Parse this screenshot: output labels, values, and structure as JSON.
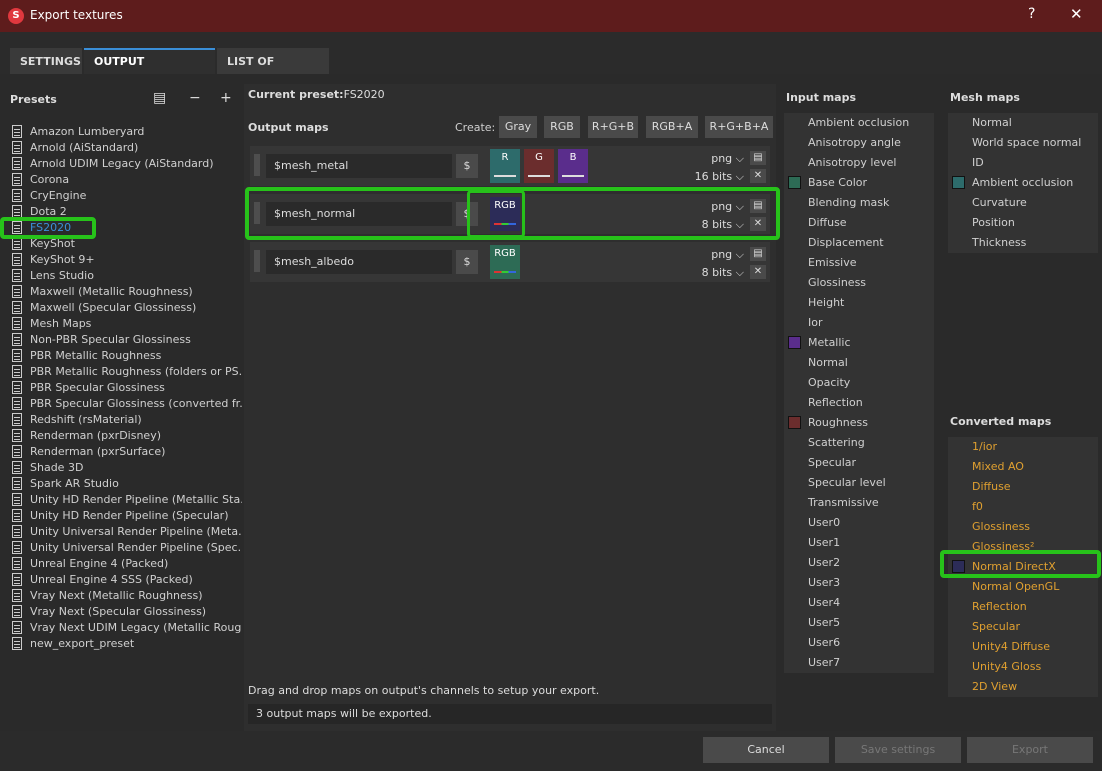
{
  "window": {
    "title": "Export textures",
    "help": "?",
    "close": "✕"
  },
  "tabs": [
    {
      "label": "SETTINGS",
      "active": false
    },
    {
      "label": "OUTPUT TEMPLATES",
      "active": true
    },
    {
      "label": "LIST OF EXPORTS",
      "active": false
    }
  ],
  "presets": {
    "title": "Presets",
    "items": [
      "Amazon Lumberyard",
      "Arnold (AiStandard)",
      "Arnold UDIM Legacy (AiStandard)",
      "Corona",
      "CryEngine",
      "Dota 2",
      "FS2020",
      "KeyShot",
      "KeyShot 9+",
      "Lens Studio",
      "Maxwell (Metallic Roughness)",
      "Maxwell (Specular Glossiness)",
      "Mesh Maps",
      "Non-PBR Specular Glossiness",
      "PBR Metallic Roughness",
      "PBR Metallic Roughness (folders or PS...",
      "PBR Specular Glossiness",
      "PBR Specular Glossiness (converted fr...",
      "Redshift (rsMaterial)",
      "Renderman (pxrDisney)",
      "Renderman (pxrSurface)",
      "Shade 3D",
      "Spark AR Studio",
      "Unity HD Render Pipeline (Metallic Sta...",
      "Unity HD Render Pipeline (Specular)",
      "Unity Universal Render Pipeline (Meta...",
      "Unity Universal Render Pipeline (Spec...",
      "Unreal Engine 4 (Packed)",
      "Unreal Engine 4 SSS (Packed)",
      "Vray Next (Metallic Roughness)",
      "Vray Next (Specular Glossiness)",
      "Vray Next UDIM Legacy (Metallic Roug...",
      "new_export_preset"
    ],
    "selected": "FS2020"
  },
  "current": {
    "label": "Current preset:",
    "value": "FS2020"
  },
  "output": {
    "label": "Output maps",
    "create_label": "Create:",
    "create_buttons": [
      "Gray",
      "RGB",
      "R+G+B",
      "RGB+A",
      "R+G+B+A"
    ],
    "rows": [
      {
        "name": "$mesh_metal",
        "dollar": "$",
        "format": "png",
        "bits": "16 bits",
        "channels": [
          {
            "label": "R",
            "color": "#2d6b6b"
          },
          {
            "label": "G",
            "color": "#6b2d2d"
          },
          {
            "label": "B",
            "color": "#5a2d8c"
          }
        ]
      },
      {
        "name": "$mesh_normal",
        "dollar": "$",
        "format": "png",
        "bits": "8 bits",
        "channels": [
          {
            "label": "RGB",
            "color": "#2c2c58"
          }
        ]
      },
      {
        "name": "$mesh_albedo",
        "dollar": "$",
        "format": "png",
        "bits": "8 bits",
        "channels": [
          {
            "label": "RGB",
            "color": "#2d6b55"
          }
        ]
      }
    ],
    "hint": "Drag and drop maps on output's channels to setup your export.",
    "status": "3 output maps will be exported."
  },
  "input_maps": {
    "title": "Input maps",
    "items": [
      {
        "label": "Ambient occlusion",
        "swatch": ""
      },
      {
        "label": "Anisotropy angle",
        "swatch": ""
      },
      {
        "label": "Anisotropy level",
        "swatch": ""
      },
      {
        "label": "Base Color",
        "swatch": "#2d6b55"
      },
      {
        "label": "Blending mask",
        "swatch": ""
      },
      {
        "label": "Diffuse",
        "swatch": ""
      },
      {
        "label": "Displacement",
        "swatch": ""
      },
      {
        "label": "Emissive",
        "swatch": ""
      },
      {
        "label": "Glossiness",
        "swatch": ""
      },
      {
        "label": "Height",
        "swatch": ""
      },
      {
        "label": "Ior",
        "swatch": ""
      },
      {
        "label": "Metallic",
        "swatch": "#5a2d8c"
      },
      {
        "label": "Normal",
        "swatch": ""
      },
      {
        "label": "Opacity",
        "swatch": ""
      },
      {
        "label": "Reflection",
        "swatch": ""
      },
      {
        "label": "Roughness",
        "swatch": "#6b2d2d"
      },
      {
        "label": "Scattering",
        "swatch": ""
      },
      {
        "label": "Specular",
        "swatch": ""
      },
      {
        "label": "Specular level",
        "swatch": ""
      },
      {
        "label": "Transmissive",
        "swatch": ""
      },
      {
        "label": "User0",
        "swatch": ""
      },
      {
        "label": "User1",
        "swatch": ""
      },
      {
        "label": "User2",
        "swatch": ""
      },
      {
        "label": "User3",
        "swatch": ""
      },
      {
        "label": "User4",
        "swatch": ""
      },
      {
        "label": "User5",
        "swatch": ""
      },
      {
        "label": "User6",
        "swatch": ""
      },
      {
        "label": "User7",
        "swatch": ""
      }
    ]
  },
  "mesh_maps": {
    "title": "Mesh maps",
    "items": [
      {
        "label": "Normal",
        "swatch": ""
      },
      {
        "label": "World space normal",
        "swatch": ""
      },
      {
        "label": "ID",
        "swatch": ""
      },
      {
        "label": "Ambient occlusion",
        "swatch": "#2d6b6b"
      },
      {
        "label": "Curvature",
        "swatch": ""
      },
      {
        "label": "Position",
        "swatch": ""
      },
      {
        "label": "Thickness",
        "swatch": ""
      }
    ]
  },
  "converted_maps": {
    "title": "Converted maps",
    "items": [
      {
        "label": "1/ior",
        "swatch": ""
      },
      {
        "label": "Mixed AO",
        "swatch": ""
      },
      {
        "label": "Diffuse",
        "swatch": ""
      },
      {
        "label": "f0",
        "swatch": ""
      },
      {
        "label": "Glossiness",
        "swatch": ""
      },
      {
        "label": "Glossiness²",
        "swatch": ""
      },
      {
        "label": "Normal DirectX",
        "swatch": "#2c2c58"
      },
      {
        "label": "Normal OpenGL",
        "swatch": ""
      },
      {
        "label": "Reflection",
        "swatch": ""
      },
      {
        "label": "Specular",
        "swatch": ""
      },
      {
        "label": "Unity4 Diffuse",
        "swatch": ""
      },
      {
        "label": "Unity4 Gloss",
        "swatch": ""
      },
      {
        "label": "2D View",
        "swatch": ""
      }
    ]
  },
  "footer": {
    "cancel": "Cancel",
    "save": "Save settings",
    "export": "Export"
  },
  "colors": {
    "accent": "#3a8fd8",
    "titlebar": "#5e1c1c",
    "highlight": "#27c21a",
    "converted_text": "#e0a030"
  }
}
